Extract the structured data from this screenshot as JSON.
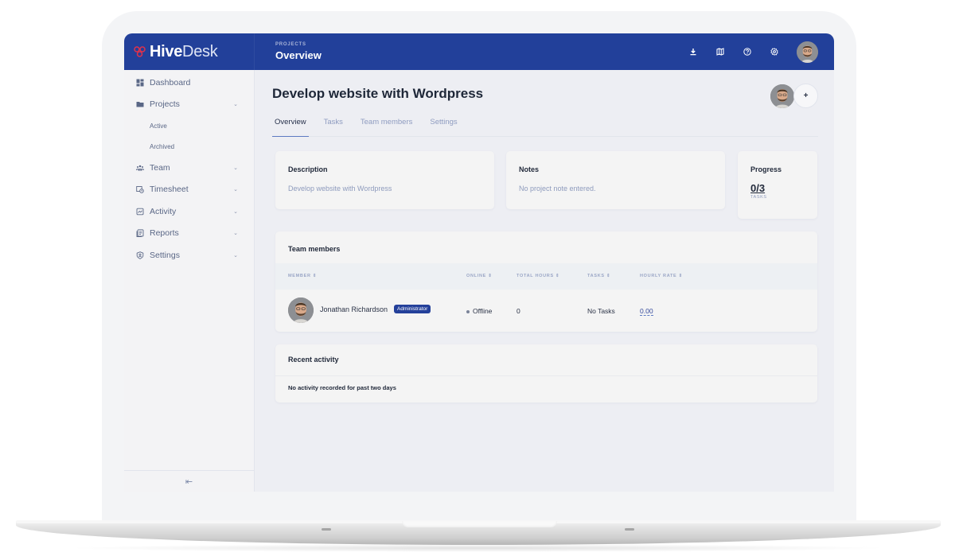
{
  "app": {
    "brand_bold": "Hive",
    "brand_light": "Desk",
    "brand_color": "#22409a",
    "logo_color": "#e0314b"
  },
  "header": {
    "breadcrumb": "PROJECTS",
    "title": "Overview",
    "icons": [
      "download-icon",
      "map-icon",
      "help-icon",
      "settings-icon"
    ],
    "user_avatar": "user-avatar"
  },
  "sidebar": {
    "items": [
      {
        "label": "Dashboard",
        "icon": "dashboard-icon",
        "expandable": false
      },
      {
        "label": "Projects",
        "icon": "folder-icon",
        "expandable": true,
        "children": [
          "Active",
          "Archived"
        ]
      },
      {
        "label": "Team",
        "icon": "team-icon",
        "expandable": true
      },
      {
        "label": "Timesheet",
        "icon": "timesheet-icon",
        "expandable": true
      },
      {
        "label": "Activity",
        "icon": "activity-icon",
        "expandable": true
      },
      {
        "label": "Reports",
        "icon": "reports-icon",
        "expandable": true
      },
      {
        "label": "Settings",
        "icon": "shield-icon",
        "expandable": true
      }
    ],
    "collapse_icon": "collapse-sidebar-icon"
  },
  "project": {
    "title": "Develop website with Wordpress",
    "add_member_label": "+",
    "tabs": [
      {
        "label": "Overview",
        "active": true
      },
      {
        "label": "Tasks",
        "active": false
      },
      {
        "label": "Team members",
        "active": false
      },
      {
        "label": "Settings",
        "active": false
      }
    ]
  },
  "cards": {
    "description": {
      "title": "Description",
      "text": "Develop website with Wordpress"
    },
    "notes": {
      "title": "Notes",
      "text": "No project note entered."
    },
    "progress": {
      "title": "Progress",
      "value": "0/3",
      "unit": "TASKS"
    }
  },
  "team": {
    "title": "Team members",
    "columns": [
      "MEMBER",
      "ONLINE",
      "TOTAL HOURS",
      "TASKS",
      "HOURLY RATE"
    ],
    "sort_glyph": "⇕",
    "rows": [
      {
        "name": "Jonathan Richardson",
        "role": "Administrator",
        "online": "Offline",
        "total_hours": "0",
        "tasks": "No Tasks",
        "hourly_rate": "0.00"
      }
    ]
  },
  "activity": {
    "title": "Recent activity",
    "empty_text": "No activity recorded for past two days"
  }
}
